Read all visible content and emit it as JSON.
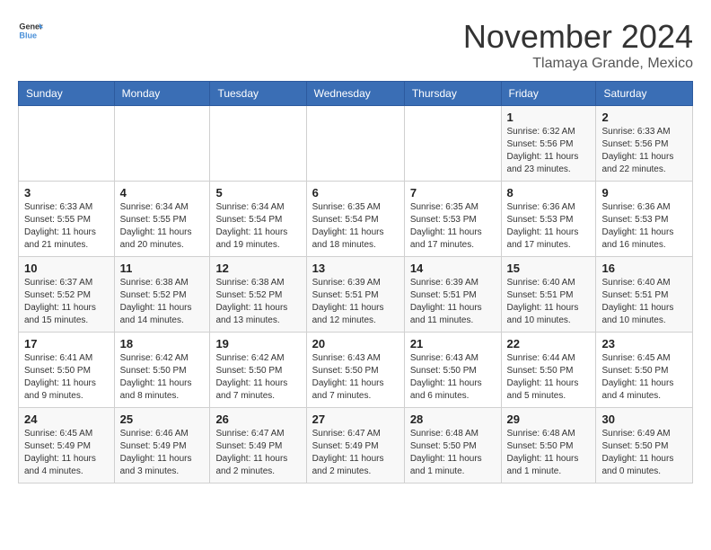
{
  "logo": {
    "text_general": "General",
    "text_blue": "Blue"
  },
  "title": "November 2024",
  "location": "Tlamaya Grande, Mexico",
  "days_of_week": [
    "Sunday",
    "Monday",
    "Tuesday",
    "Wednesday",
    "Thursday",
    "Friday",
    "Saturday"
  ],
  "weeks": [
    [
      {
        "day": "",
        "info": ""
      },
      {
        "day": "",
        "info": ""
      },
      {
        "day": "",
        "info": ""
      },
      {
        "day": "",
        "info": ""
      },
      {
        "day": "",
        "info": ""
      },
      {
        "day": "1",
        "info": "Sunrise: 6:32 AM\nSunset: 5:56 PM\nDaylight: 11 hours and 23 minutes."
      },
      {
        "day": "2",
        "info": "Sunrise: 6:33 AM\nSunset: 5:56 PM\nDaylight: 11 hours and 22 minutes."
      }
    ],
    [
      {
        "day": "3",
        "info": "Sunrise: 6:33 AM\nSunset: 5:55 PM\nDaylight: 11 hours and 21 minutes."
      },
      {
        "day": "4",
        "info": "Sunrise: 6:34 AM\nSunset: 5:55 PM\nDaylight: 11 hours and 20 minutes."
      },
      {
        "day": "5",
        "info": "Sunrise: 6:34 AM\nSunset: 5:54 PM\nDaylight: 11 hours and 19 minutes."
      },
      {
        "day": "6",
        "info": "Sunrise: 6:35 AM\nSunset: 5:54 PM\nDaylight: 11 hours and 18 minutes."
      },
      {
        "day": "7",
        "info": "Sunrise: 6:35 AM\nSunset: 5:53 PM\nDaylight: 11 hours and 17 minutes."
      },
      {
        "day": "8",
        "info": "Sunrise: 6:36 AM\nSunset: 5:53 PM\nDaylight: 11 hours and 17 minutes."
      },
      {
        "day": "9",
        "info": "Sunrise: 6:36 AM\nSunset: 5:53 PM\nDaylight: 11 hours and 16 minutes."
      }
    ],
    [
      {
        "day": "10",
        "info": "Sunrise: 6:37 AM\nSunset: 5:52 PM\nDaylight: 11 hours and 15 minutes."
      },
      {
        "day": "11",
        "info": "Sunrise: 6:38 AM\nSunset: 5:52 PM\nDaylight: 11 hours and 14 minutes."
      },
      {
        "day": "12",
        "info": "Sunrise: 6:38 AM\nSunset: 5:52 PM\nDaylight: 11 hours and 13 minutes."
      },
      {
        "day": "13",
        "info": "Sunrise: 6:39 AM\nSunset: 5:51 PM\nDaylight: 11 hours and 12 minutes."
      },
      {
        "day": "14",
        "info": "Sunrise: 6:39 AM\nSunset: 5:51 PM\nDaylight: 11 hours and 11 minutes."
      },
      {
        "day": "15",
        "info": "Sunrise: 6:40 AM\nSunset: 5:51 PM\nDaylight: 11 hours and 10 minutes."
      },
      {
        "day": "16",
        "info": "Sunrise: 6:40 AM\nSunset: 5:51 PM\nDaylight: 11 hours and 10 minutes."
      }
    ],
    [
      {
        "day": "17",
        "info": "Sunrise: 6:41 AM\nSunset: 5:50 PM\nDaylight: 11 hours and 9 minutes."
      },
      {
        "day": "18",
        "info": "Sunrise: 6:42 AM\nSunset: 5:50 PM\nDaylight: 11 hours and 8 minutes."
      },
      {
        "day": "19",
        "info": "Sunrise: 6:42 AM\nSunset: 5:50 PM\nDaylight: 11 hours and 7 minutes."
      },
      {
        "day": "20",
        "info": "Sunrise: 6:43 AM\nSunset: 5:50 PM\nDaylight: 11 hours and 7 minutes."
      },
      {
        "day": "21",
        "info": "Sunrise: 6:43 AM\nSunset: 5:50 PM\nDaylight: 11 hours and 6 minutes."
      },
      {
        "day": "22",
        "info": "Sunrise: 6:44 AM\nSunset: 5:50 PM\nDaylight: 11 hours and 5 minutes."
      },
      {
        "day": "23",
        "info": "Sunrise: 6:45 AM\nSunset: 5:50 PM\nDaylight: 11 hours and 4 minutes."
      }
    ],
    [
      {
        "day": "24",
        "info": "Sunrise: 6:45 AM\nSunset: 5:49 PM\nDaylight: 11 hours and 4 minutes."
      },
      {
        "day": "25",
        "info": "Sunrise: 6:46 AM\nSunset: 5:49 PM\nDaylight: 11 hours and 3 minutes."
      },
      {
        "day": "26",
        "info": "Sunrise: 6:47 AM\nSunset: 5:49 PM\nDaylight: 11 hours and 2 minutes."
      },
      {
        "day": "27",
        "info": "Sunrise: 6:47 AM\nSunset: 5:49 PM\nDaylight: 11 hours and 2 minutes."
      },
      {
        "day": "28",
        "info": "Sunrise: 6:48 AM\nSunset: 5:50 PM\nDaylight: 11 hours and 1 minute."
      },
      {
        "day": "29",
        "info": "Sunrise: 6:48 AM\nSunset: 5:50 PM\nDaylight: 11 hours and 1 minute."
      },
      {
        "day": "30",
        "info": "Sunrise: 6:49 AM\nSunset: 5:50 PM\nDaylight: 11 hours and 0 minutes."
      }
    ]
  ]
}
